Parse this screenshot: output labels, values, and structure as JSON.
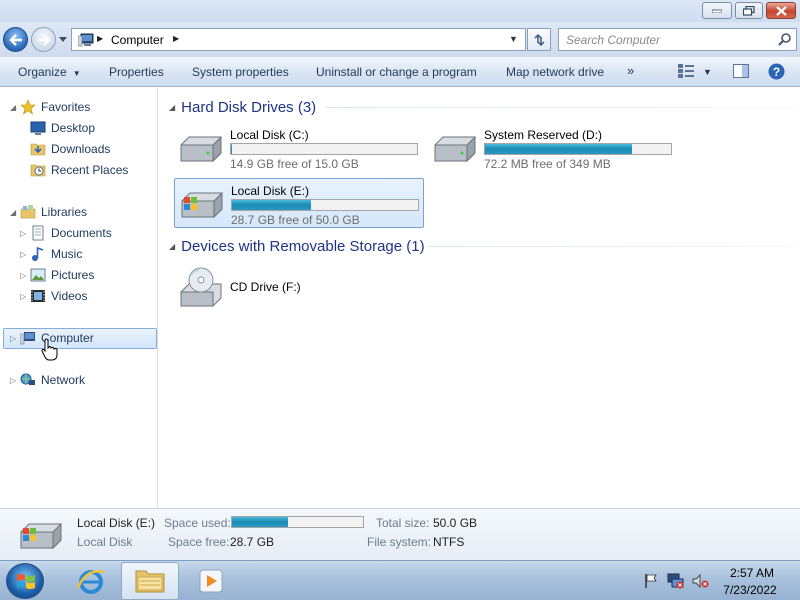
{
  "window": {
    "controls": [
      "minimize",
      "maximize",
      "close"
    ]
  },
  "address": {
    "path": "Computer",
    "search_placeholder": "Search Computer"
  },
  "toolbar": {
    "organize": "Organize",
    "properties": "Properties",
    "system_properties": "System properties",
    "uninstall": "Uninstall or change a program",
    "map_drive": "Map network drive",
    "more": "»"
  },
  "nav": {
    "favorites": "Favorites",
    "desktop": "Desktop",
    "downloads": "Downloads",
    "recent": "Recent Places",
    "libraries": "Libraries",
    "documents": "Documents",
    "music": "Music",
    "pictures": "Pictures",
    "videos": "Videos",
    "computer": "Computer",
    "network": "Network"
  },
  "content": {
    "hdd_header": "Hard Disk Drives (3)",
    "removable_header": "Devices with Removable Storage (1)",
    "drives": [
      {
        "name": "Local Disk (C:)",
        "free": "14.9 GB free of 15.0 GB",
        "used_fraction": 0.007
      },
      {
        "name": "System Reserved (D:)",
        "free": "72.2 MB free of 349 MB",
        "used_fraction": 0.79
      },
      {
        "name": "Local Disk (E:)",
        "free": "28.7 GB free of 50.0 GB",
        "used_fraction": 0.426
      }
    ],
    "cd": {
      "name": "CD Drive (F:)"
    }
  },
  "details": {
    "name": "Local Disk (E:)",
    "type": "Local Disk",
    "space_used_label": "Space used:",
    "space_free_label": "Space free:",
    "space_free": "28.7 GB",
    "total_size_label": "Total size:",
    "total_size": "50.0 GB",
    "file_system_label": "File system:",
    "file_system": "NTFS",
    "used_fraction": 0.426
  },
  "taskbar": {
    "time": "2:57 AM",
    "date": "7/23/2022"
  },
  "colors": {
    "accent": "#1e395b",
    "bar_fill": "#1b89b4",
    "selection": "#d3e6fa"
  }
}
